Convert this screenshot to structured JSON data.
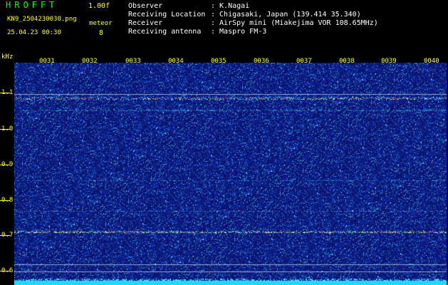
{
  "header": {
    "app_title": "HROFFT",
    "version": "1.00f",
    "filename": "KN9_2504230030.png",
    "datetime": "25.04.23 00:30",
    "mode_label": "meteor",
    "mode_value": "8"
  },
  "info": [
    {
      "label": "Observer",
      "value": ": K.Nagai"
    },
    {
      "label": "Receiving Location",
      "value": ": Chigasaki, Japan (139.414 35.340)"
    },
    {
      "label": "Receiver",
      "value": ": AirSpy mini (Miakejima VOR 108.65MHz)"
    },
    {
      "label": "Receiving antenna",
      "value": ": Maspro FM-3"
    }
  ],
  "axis": {
    "y_unit": "kHz",
    "y_ticks": [
      "1.1",
      "1.0",
      "0.9",
      "0.8",
      "0.7",
      "0.6"
    ],
    "x_ticks": [
      "0031",
      "0032",
      "0033",
      "0034",
      "0035",
      "0036",
      "0037",
      "0038",
      "0039",
      "0040"
    ]
  },
  "colors": {
    "background": "#000000",
    "plot_bg": "#0a1a6e",
    "label_yellow": "#ffff00",
    "title_green": "#00ff00"
  }
}
